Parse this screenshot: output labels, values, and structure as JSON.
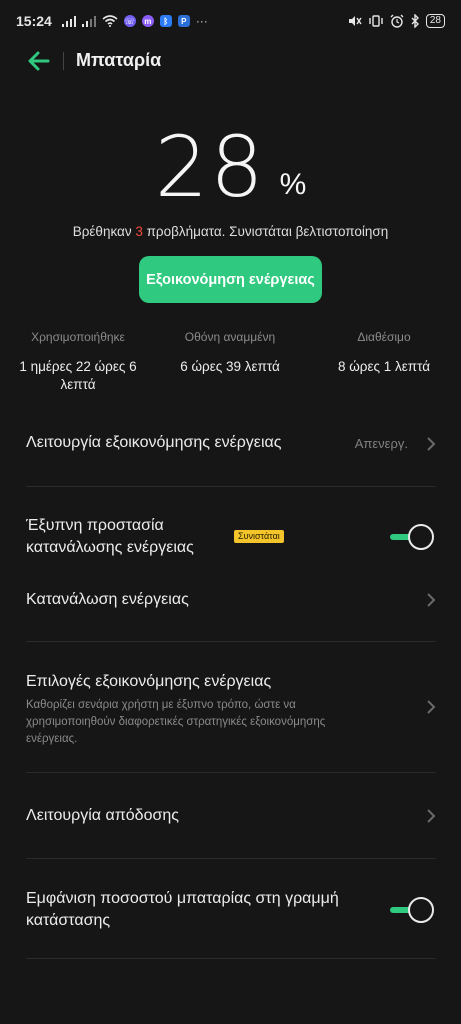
{
  "status_bar": {
    "time": "15:24",
    "battery_level": "28",
    "overflow": "···",
    "left_icons": [
      "signal-icon",
      "signal-icon",
      "wifi-icon",
      "viber-icon",
      "messenger-icon",
      "bluetooth-app-icon",
      "paypal-icon"
    ],
    "right_icons": [
      "mute-icon",
      "vibrate-icon",
      "alarm-icon",
      "bluetooth-icon",
      "battery-icon"
    ]
  },
  "header": {
    "title": "Μπαταρία",
    "back_icon": "arrow-left-icon",
    "accent": "#2fc97f"
  },
  "battery": {
    "percent": "28",
    "percent_sign": "%"
  },
  "issues": {
    "prefix": "Βρέθηκαν ",
    "count": "3",
    "suffix": " προβλήματα. Συνιστάται βελτιστοποίηση",
    "count_color": "#f24b3a"
  },
  "optimize_button": {
    "label": "Εξοικονόμηση ενέργειας",
    "color": "#2fc97f"
  },
  "stats": [
    {
      "label": "Χρησιμοποιήθηκε",
      "value": "1 ημέρες 22 ώρες 6 λεπτά"
    },
    {
      "label": "Οθόνη αναμμένη",
      "value": "6 ώρες 39 λεπτά"
    },
    {
      "label": "Διαθέσιμο",
      "value": "8 ώρες 1 λεπτά"
    }
  ],
  "settings": {
    "power_saving_mode": {
      "title": "Λειτουργία εξοικονόμησης ενέργειας",
      "value": "Απενεργ."
    },
    "smart_protection": {
      "title": "Έξυπνη προστασία κατανάλωσης ενέργειας",
      "badge": "Συνιστάται",
      "enabled": true
    },
    "power_consumption": {
      "title": "Κατανάλωση ενέργειας"
    },
    "saving_options": {
      "title": "Επιλογές εξοικονόμησης ενέργειας",
      "description": "Καθορίζει σενάρια χρήστη με έξυπνο τρόπο, ώστε να χρησιμοποιηθούν διαφορετικές στρατηγικές εξοικονόμησης ενέργειας."
    },
    "performance_mode": {
      "title": "Λειτουργία απόδοσης"
    },
    "show_percentage": {
      "title": "Εμφάνιση ποσοστού μπαταρίας στη γραμμή κατάστασης",
      "enabled": true
    }
  }
}
